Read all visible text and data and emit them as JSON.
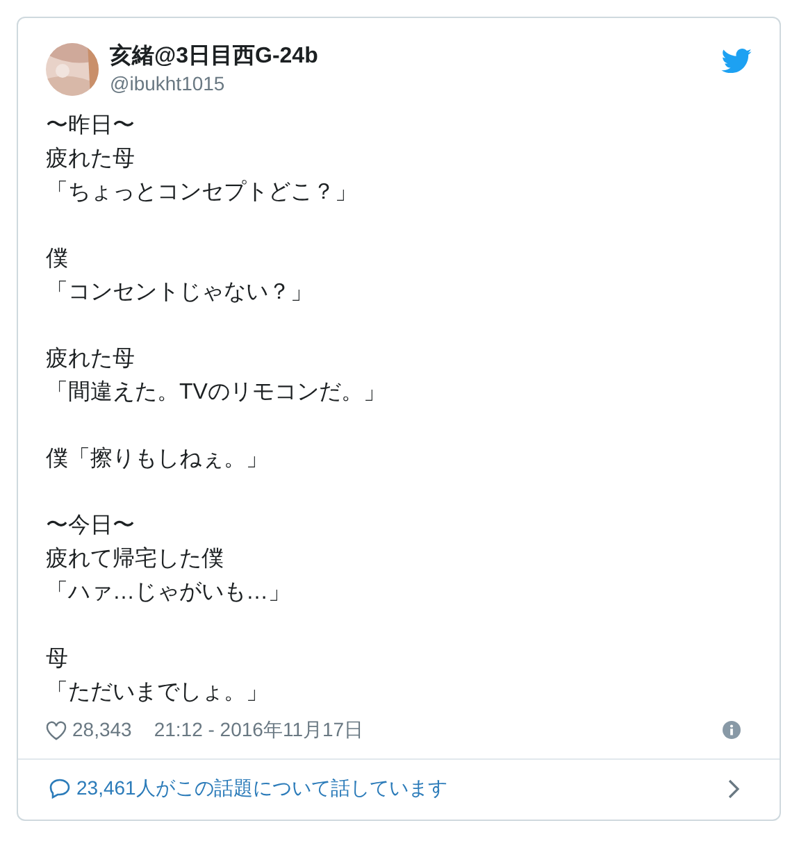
{
  "author": {
    "name": "亥緒@3日目西G-24b",
    "handle": "@ibukht1015"
  },
  "paragraphs": [
    [
      "〜昨日〜",
      "疲れた母",
      "「ちょっとコンセプトどこ？」"
    ],
    [
      "僕",
      "「コンセントじゃない？」"
    ],
    [
      "疲れた母",
      "「間違えた。TVのリモコンだ。」"
    ],
    [
      "僕「擦りもしねぇ。」"
    ],
    [
      "〜今日〜",
      "疲れて帰宅した僕",
      "「ハァ…じゃがいも…」"
    ],
    [
      "母",
      "「ただいまでしょ。」"
    ]
  ],
  "likes": "28,343",
  "timestamp": "21:12 - 2016年11月17日",
  "conversation": "23,461人がこの話題について話しています"
}
